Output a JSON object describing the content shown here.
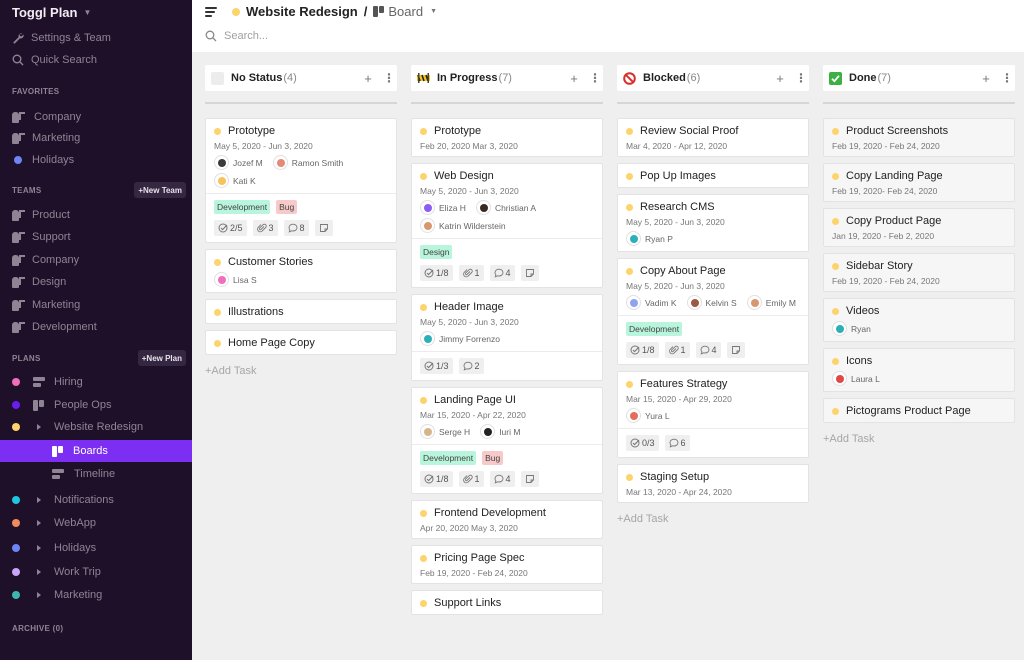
{
  "app": {
    "title": "Toggl Plan"
  },
  "sidebar": {
    "top_items": [
      {
        "label": "Settings & Team",
        "icon": "wrench-icon"
      },
      {
        "label": "Quick Search",
        "icon": "search-icon"
      }
    ],
    "favorites_label": "FAVORITES",
    "favorites": [
      {
        "label": "Company",
        "icon": "team-icon"
      },
      {
        "label": "Marketing",
        "icon": "team-icon"
      },
      {
        "label": "Holidays",
        "icon": "dot",
        "color": "#6f83f5"
      }
    ],
    "teams_label": "TEAMS",
    "new_team_label": "+New Team",
    "teams": [
      {
        "label": "Product"
      },
      {
        "label": "Support"
      },
      {
        "label": "Company"
      },
      {
        "label": "Design"
      },
      {
        "label": "Marketing"
      },
      {
        "label": "Development"
      }
    ],
    "plans_label": "PLANS",
    "new_plan_label": "+New Plan",
    "plans": [
      {
        "label": "Hiring",
        "color": "#f06ebd",
        "icon": "timeline-icon"
      },
      {
        "label": "People Ops",
        "color": "#6a1cf5",
        "icon": "board-icon"
      },
      {
        "label": "Website Redesign",
        "color": "#fdd36b",
        "expanded": true,
        "children": [
          {
            "label": "Boards",
            "icon": "board-icon",
            "active": true
          },
          {
            "label": "Timeline",
            "icon": "timeline-icon"
          }
        ]
      },
      {
        "label": "Notifications",
        "color": "#1fc6e0"
      },
      {
        "label": "WebApp",
        "color": "#f08b5e"
      },
      {
        "label": "Holidays",
        "color": "#6f83f5"
      },
      {
        "label": "Work Trip",
        "color": "#c6a6f5"
      },
      {
        "label": "Marketing",
        "color": "#3fb5b0"
      }
    ],
    "archive_label": "ARCHIVE (0)"
  },
  "header": {
    "project_color": "#fdd36b",
    "project_name": "Website Redesign",
    "separator": "/",
    "view_name": "Board",
    "search_placeholder": "Search..."
  },
  "colors": {
    "accent": "#7c2ef2",
    "sidebar_bg": "#1f1029",
    "task_dot": "#fdd36b",
    "tag_development": "#b8f5dc",
    "tag_bug": "#f8c9c9",
    "tag_design": "#b8f5dc"
  },
  "board": {
    "add_task_label": "+Add Task",
    "columns": [
      {
        "name": "No Status",
        "count": "(4)",
        "icon": "empty-status-icon",
        "cards": [
          {
            "title": "Prototype",
            "date": "May 5, 2020 - Jun 3, 2020",
            "assignees": [
              {
                "name": "Jozef M",
                "color": "#3a3a3a"
              },
              {
                "name": "Ramon Smith",
                "color": "#e58a78"
              },
              {
                "name": "Kati K",
                "color": "#f6c45a"
              }
            ],
            "tags": [
              {
                "label": "Development",
                "color": "#b8f5dc"
              },
              {
                "label": "Bug",
                "color": "#f8c9c9"
              }
            ],
            "badges": {
              "checklist": "2/5",
              "attachments": "3",
              "comments": "8",
              "note": true
            }
          },
          {
            "title": "Customer Stories",
            "assignees": [
              {
                "name": "Lisa S",
                "color": "#f06ebd"
              }
            ]
          },
          {
            "title": "Illustrations"
          },
          {
            "title": "Home Page Copy"
          }
        ]
      },
      {
        "name": "In Progress",
        "count": "(7)",
        "icon": "construction-icon",
        "cards": [
          {
            "title": "Prototype",
            "date": "Feb 20, 2020 Mar 3, 2020"
          },
          {
            "title": "Web Design",
            "date": "May 5, 2020 - Jun 3, 2020",
            "assignees": [
              {
                "name": "Eliza H",
                "color": "#8b5cf6"
              },
              {
                "name": "Christian A",
                "color": "#3a2a22"
              },
              {
                "name": "Katrin Wilderstein",
                "color": "#d99770"
              }
            ],
            "tags": [
              {
                "label": "Design",
                "color": "#b8f5dc"
              }
            ],
            "badges": {
              "checklist": "1/8",
              "attachments": "1",
              "comments": "4",
              "note": true
            }
          },
          {
            "title": "Header Image",
            "date": "May 5, 2020 - Jun 3, 2020",
            "assignees": [
              {
                "name": "Jimmy Forrenzo",
                "color": "#2bb0b8"
              }
            ],
            "badges": {
              "checklist": "1/3",
              "comments": "2"
            }
          },
          {
            "title": "Landing Page UI",
            "date": "Mar 15, 2020 - Apr 22, 2020",
            "assignees": [
              {
                "name": "Serge H",
                "color": "#d9b48a"
              },
              {
                "name": "Iuri M",
                "color": "#222"
              }
            ],
            "tags": [
              {
                "label": "Development",
                "color": "#b8f5dc"
              },
              {
                "label": "Bug",
                "color": "#f8c9c9"
              }
            ],
            "badges": {
              "checklist": "1/8",
              "attachments": "1",
              "comments": "4",
              "note": true
            }
          },
          {
            "title": "Frontend Development",
            "date": "Apr 20, 2020 May 3, 2020"
          },
          {
            "title": "Pricing Page Spec",
            "date": "Feb 19, 2020 - Feb 24, 2020"
          },
          {
            "title": "Support Links"
          }
        ]
      },
      {
        "name": "Blocked",
        "count": "(6)",
        "icon": "no-entry-icon",
        "cards": [
          {
            "title": "Review Social Proof",
            "date": "Mar 4, 2020 - Apr 12, 2020"
          },
          {
            "title": "Pop Up Images"
          },
          {
            "title": "Research CMS",
            "date": "May 5, 2020 - Jun 3, 2020",
            "assignees": [
              {
                "name": "Ryan P",
                "color": "#2bb0b8"
              }
            ]
          },
          {
            "title": "Copy About Page",
            "date": "May 5, 2020 - Jun 3, 2020",
            "assignees": [
              {
                "name": "Vadim K",
                "color": "#8fa3f0"
              },
              {
                "name": "Kelvin S",
                "color": "#9a5a44"
              },
              {
                "name": "Emily M",
                "color": "#d99770"
              }
            ],
            "tags": [
              {
                "label": "Development",
                "color": "#b8f5dc"
              }
            ],
            "badges": {
              "checklist": "1/8",
              "attachments": "1",
              "comments": "4",
              "note": true
            }
          },
          {
            "title": "Features Strategy",
            "date": "Mar 15, 2020 - Apr 29, 2020",
            "assignees": [
              {
                "name": "Yura L",
                "color": "#e0705a"
              }
            ],
            "badges": {
              "checklist": "0/3",
              "comments": "6"
            }
          },
          {
            "title": "Staging Setup",
            "date": "Mar 13, 2020 - Apr 24, 2020"
          }
        ]
      },
      {
        "name": "Done",
        "count": "(7)",
        "icon": "check-mark-icon",
        "cards": [
          {
            "title": "Product Screenshots",
            "date": "Feb 19, 2020 - Feb 24, 2020"
          },
          {
            "title": "Copy Landing Page",
            "date": "Feb 19, 2020- Feb 24, 2020"
          },
          {
            "title": "Copy Product Page",
            "date": "Jan 19, 2020 - Feb 2, 2020"
          },
          {
            "title": "Sidebar Story",
            "date": "Feb 19, 2020 - Feb 24, 2020"
          },
          {
            "title": "Videos",
            "assignees": [
              {
                "name": "Ryan",
                "color": "#2bb0b8"
              }
            ]
          },
          {
            "title": "Icons",
            "assignees": [
              {
                "name": "Laura L",
                "color": "#e04848"
              }
            ]
          },
          {
            "title": "Pictograms Product Page"
          }
        ]
      }
    ]
  }
}
